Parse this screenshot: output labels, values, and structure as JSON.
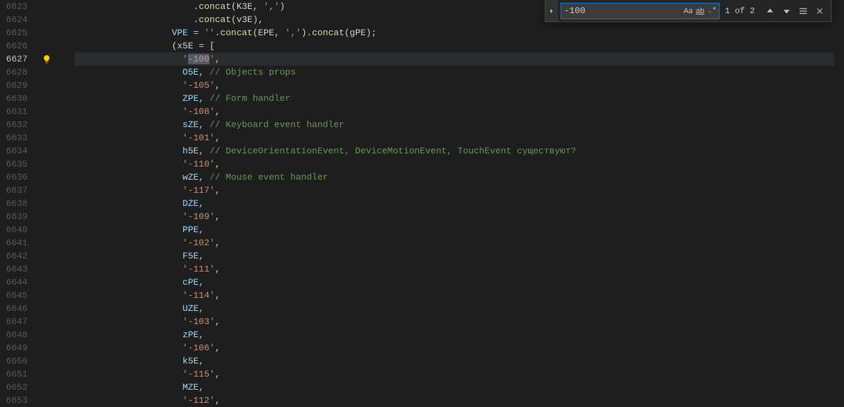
{
  "find": {
    "query": "-100",
    "count_label": "1 of 2"
  },
  "active_line": 6627,
  "lines": [
    {
      "num": 6623,
      "indent": 11,
      "segs": [
        {
          "t": ".",
          "c": "punc"
        },
        {
          "t": "concat",
          "c": "fn"
        },
        {
          "t": "(K3E, ",
          "c": "punc"
        },
        {
          "t": "','",
          "c": "str"
        },
        {
          "t": ")",
          "c": "punc"
        }
      ]
    },
    {
      "num": 6624,
      "indent": 11,
      "segs": [
        {
          "t": ".",
          "c": "punc"
        },
        {
          "t": "concat",
          "c": "fn"
        },
        {
          "t": "(v3E),",
          "c": "punc"
        }
      ]
    },
    {
      "num": 6625,
      "indent": 9,
      "segs": [
        {
          "t": "VPE = ",
          "c": "var"
        },
        {
          "t": "''",
          "c": "str"
        },
        {
          "t": ".",
          "c": "punc"
        },
        {
          "t": "concat",
          "c": "fn"
        },
        {
          "t": "(EPE, ",
          "c": "punc"
        },
        {
          "t": "','",
          "c": "str"
        },
        {
          "t": ").",
          "c": "punc"
        },
        {
          "t": "concat",
          "c": "fn"
        },
        {
          "t": "(gPE);",
          "c": "punc"
        }
      ]
    },
    {
      "num": 6626,
      "indent": 9,
      "segs": [
        {
          "t": "(x5E = [",
          "c": "punc"
        }
      ]
    },
    {
      "num": 6627,
      "indent": 10,
      "highlight": true,
      "segs": [
        {
          "t": "'",
          "c": "str"
        },
        {
          "t": "-100",
          "c": "str",
          "sel": true
        },
        {
          "t": "'",
          "c": "str"
        },
        {
          "t": ",",
          "c": "punc"
        }
      ]
    },
    {
      "num": 6628,
      "indent": 10,
      "segs": [
        {
          "t": "O5E, ",
          "c": "var"
        },
        {
          "t": "// Objects props",
          "c": "comment"
        }
      ]
    },
    {
      "num": 6629,
      "indent": 10,
      "segs": [
        {
          "t": "'-105'",
          "c": "str"
        },
        {
          "t": ",",
          "c": "punc"
        }
      ]
    },
    {
      "num": 6630,
      "indent": 10,
      "segs": [
        {
          "t": "ZPE, ",
          "c": "var"
        },
        {
          "t": "// Form handler",
          "c": "comment"
        }
      ]
    },
    {
      "num": 6631,
      "indent": 10,
      "segs": [
        {
          "t": "'-108'",
          "c": "str"
        },
        {
          "t": ",",
          "c": "punc"
        }
      ]
    },
    {
      "num": 6632,
      "indent": 10,
      "segs": [
        {
          "t": "sZE, ",
          "c": "var"
        },
        {
          "t": "// Keyboard event handler",
          "c": "comment"
        }
      ]
    },
    {
      "num": 6633,
      "indent": 10,
      "segs": [
        {
          "t": "'-101'",
          "c": "str"
        },
        {
          "t": ",",
          "c": "punc"
        }
      ]
    },
    {
      "num": 6634,
      "indent": 10,
      "segs": [
        {
          "t": "h5E, ",
          "c": "var"
        },
        {
          "t": "// DeviceOrientationEvent, DeviceMotionEvent, TouchEvent существуют?",
          "c": "comment"
        }
      ]
    },
    {
      "num": 6635,
      "indent": 10,
      "segs": [
        {
          "t": "'-110'",
          "c": "str"
        },
        {
          "t": ",",
          "c": "punc"
        }
      ]
    },
    {
      "num": 6636,
      "indent": 10,
      "segs": [
        {
          "t": "wZE, ",
          "c": "var"
        },
        {
          "t": "// Mouse event handler",
          "c": "comment"
        }
      ]
    },
    {
      "num": 6637,
      "indent": 10,
      "segs": [
        {
          "t": "'-117'",
          "c": "str"
        },
        {
          "t": ",",
          "c": "punc"
        }
      ]
    },
    {
      "num": 6638,
      "indent": 10,
      "segs": [
        {
          "t": "DZE,",
          "c": "var"
        }
      ]
    },
    {
      "num": 6639,
      "indent": 10,
      "segs": [
        {
          "t": "'-109'",
          "c": "str"
        },
        {
          "t": ",",
          "c": "punc"
        }
      ]
    },
    {
      "num": 6640,
      "indent": 10,
      "segs": [
        {
          "t": "PPE,",
          "c": "var"
        }
      ]
    },
    {
      "num": 6641,
      "indent": 10,
      "segs": [
        {
          "t": "'-102'",
          "c": "str"
        },
        {
          "t": ",",
          "c": "punc"
        }
      ]
    },
    {
      "num": 6642,
      "indent": 10,
      "segs": [
        {
          "t": "F5E,",
          "c": "var"
        }
      ]
    },
    {
      "num": 6643,
      "indent": 10,
      "segs": [
        {
          "t": "'-111'",
          "c": "str"
        },
        {
          "t": ",",
          "c": "punc"
        }
      ]
    },
    {
      "num": 6644,
      "indent": 10,
      "segs": [
        {
          "t": "cPE,",
          "c": "var"
        }
      ]
    },
    {
      "num": 6645,
      "indent": 10,
      "segs": [
        {
          "t": "'-114'",
          "c": "str"
        },
        {
          "t": ",",
          "c": "punc"
        }
      ]
    },
    {
      "num": 6646,
      "indent": 10,
      "segs": [
        {
          "t": "UZE,",
          "c": "var"
        }
      ]
    },
    {
      "num": 6647,
      "indent": 10,
      "segs": [
        {
          "t": "'-103'",
          "c": "str"
        },
        {
          "t": ",",
          "c": "punc"
        }
      ]
    },
    {
      "num": 6648,
      "indent": 10,
      "segs": [
        {
          "t": "zPE,",
          "c": "var"
        }
      ]
    },
    {
      "num": 6649,
      "indent": 10,
      "segs": [
        {
          "t": "'-106'",
          "c": "str"
        },
        {
          "t": ",",
          "c": "punc"
        }
      ]
    },
    {
      "num": 6650,
      "indent": 10,
      "segs": [
        {
          "t": "k5E,",
          "c": "var"
        }
      ]
    },
    {
      "num": 6651,
      "indent": 10,
      "segs": [
        {
          "t": "'-115'",
          "c": "str"
        },
        {
          "t": ",",
          "c": "punc"
        }
      ]
    },
    {
      "num": 6652,
      "indent": 10,
      "segs": [
        {
          "t": "MZE,",
          "c": "var"
        }
      ]
    },
    {
      "num": 6653,
      "indent": 10,
      "segs": [
        {
          "t": "'-112'",
          "c": "str"
        },
        {
          "t": ",",
          "c": "punc"
        }
      ]
    }
  ]
}
